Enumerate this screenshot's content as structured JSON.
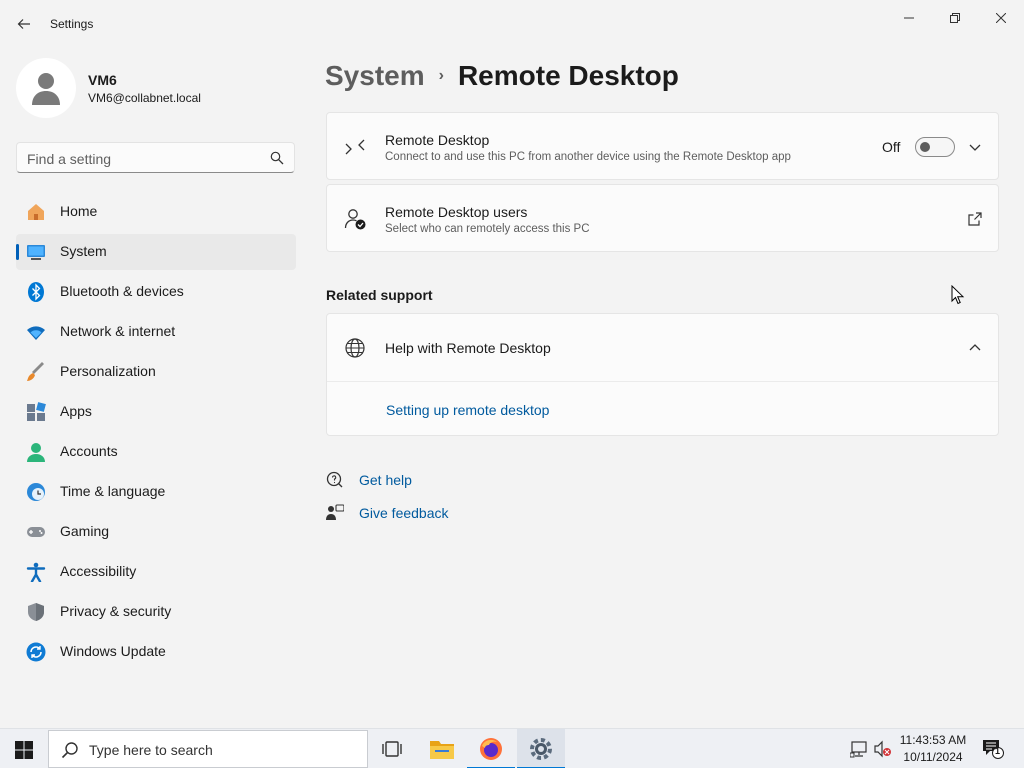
{
  "window": {
    "title": "Settings"
  },
  "profile": {
    "name": "VM6",
    "email": "VM6@collabnet.local"
  },
  "search": {
    "placeholder": "Find a setting"
  },
  "sidebar": {
    "items": [
      {
        "label": "Home",
        "icon": "home-icon"
      },
      {
        "label": "System",
        "icon": "system-icon",
        "selected": true
      },
      {
        "label": "Bluetooth & devices",
        "icon": "bluetooth-icon"
      },
      {
        "label": "Network & internet",
        "icon": "wifi-icon"
      },
      {
        "label": "Personalization",
        "icon": "brush-icon"
      },
      {
        "label": "Apps",
        "icon": "apps-icon"
      },
      {
        "label": "Accounts",
        "icon": "accounts-icon"
      },
      {
        "label": "Time & language",
        "icon": "clock-globe-icon"
      },
      {
        "label": "Gaming",
        "icon": "gamepad-icon"
      },
      {
        "label": "Accessibility",
        "icon": "accessibility-icon"
      },
      {
        "label": "Privacy & security",
        "icon": "shield-icon"
      },
      {
        "label": "Windows Update",
        "icon": "update-icon"
      }
    ]
  },
  "breadcrumb": {
    "parent": "System",
    "separator": "›",
    "current": "Remote Desktop"
  },
  "remote_desktop": {
    "title": "Remote Desktop",
    "subtitle": "Connect to and use this PC from another device using the Remote Desktop app",
    "toggle_label": "Off",
    "toggle_on": false
  },
  "remote_users": {
    "title": "Remote Desktop users",
    "subtitle": "Select who can remotely access this PC"
  },
  "related_support": {
    "heading": "Related support",
    "help_title": "Help with Remote Desktop",
    "help_link": "Setting up remote desktop"
  },
  "footer_links": {
    "get_help": "Get help",
    "give_feedback": "Give feedback"
  },
  "taskbar": {
    "search_placeholder": "Type here to search",
    "time": "11:43:53 AM",
    "date": "10/11/2024",
    "notification_count": "1"
  },
  "colors": {
    "accent": "#005fb8",
    "link": "#005a9e",
    "background": "#f3f3f3",
    "card": "#fbfbfb"
  }
}
